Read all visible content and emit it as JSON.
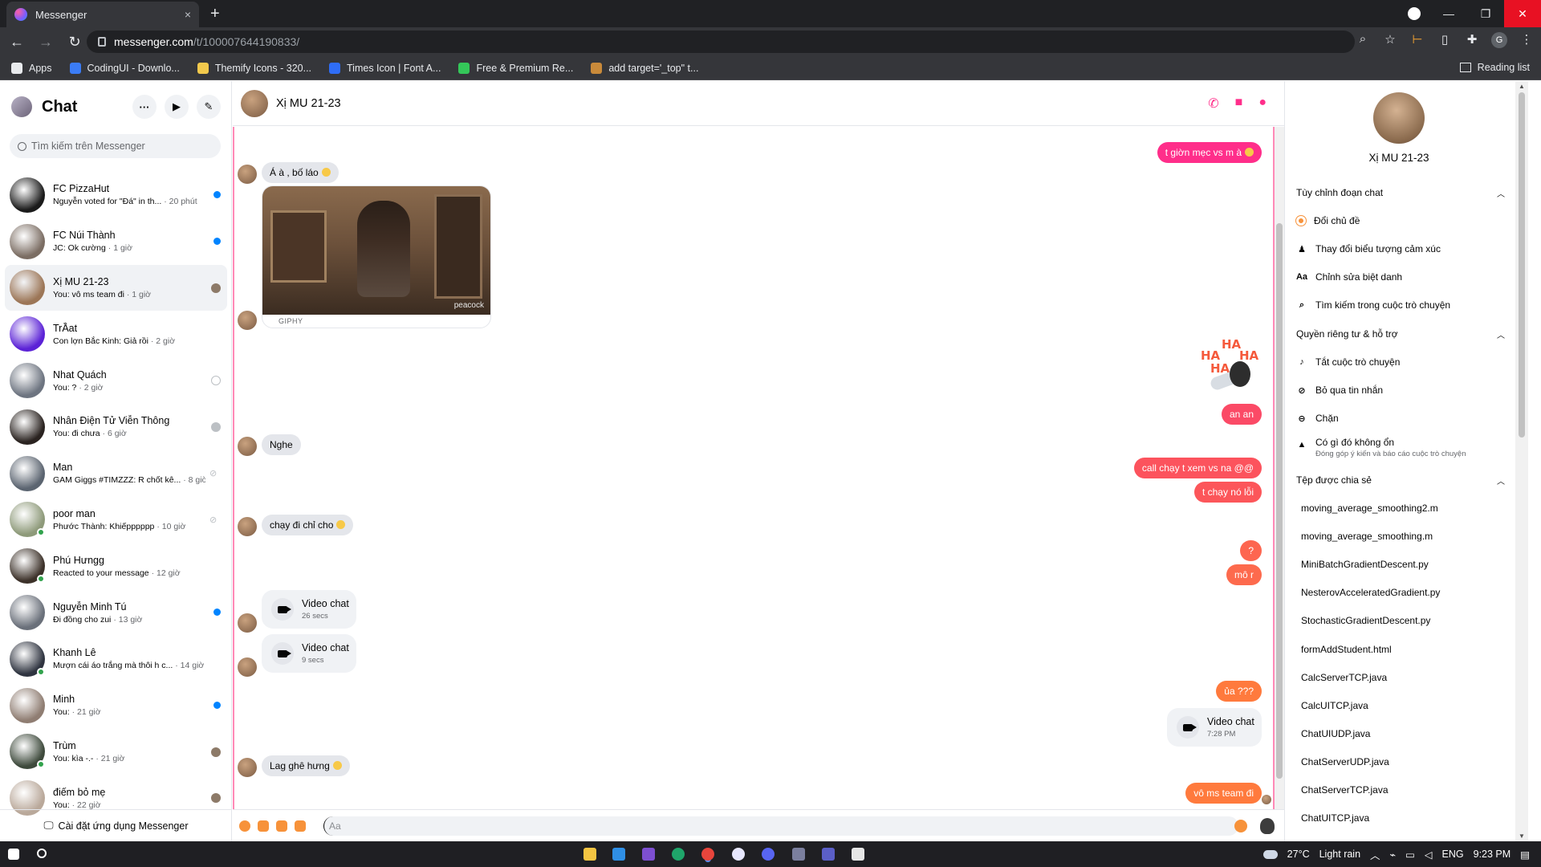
{
  "browser": {
    "tab_title": "Messenger",
    "tab_close": "×",
    "new_tab": "+",
    "url_host": "messenger.com",
    "url_path": "/t/100007644190833/",
    "bookmarks": [
      {
        "label": "Apps",
        "color": "#e8eaed"
      },
      {
        "label": "CodingUI - Downlo...",
        "color": "#3b7cf5"
      },
      {
        "label": "Themify Icons - 320...",
        "color": "#f2c94c"
      },
      {
        "label": "Times Icon | Font A...",
        "color": "#2f6df6"
      },
      {
        "label": "Free & Premium Re...",
        "color": "#34c759"
      },
      {
        "label": "add target='_top\" t...",
        "color": "#c98a3a"
      }
    ],
    "reading_list": "Reading list",
    "profile_initial": "G"
  },
  "sidebar": {
    "title": "Chat",
    "search_placeholder": "Tìm kiếm trên Messenger",
    "footer": "Cài đặt ứng dụng Messenger",
    "conversations": [
      {
        "name": "FC PizzaHut",
        "preview": "Nguyễn voted for \"Đá\" in th...",
        "time": "· 20 phút",
        "indicator": "unread",
        "online": false,
        "avatar_color": "#1b1b1b"
      },
      {
        "name": "FC Núi Thành",
        "preview": "JC: Ok cường",
        "time": "· 1 giờ",
        "indicator": "unread",
        "online": false,
        "avatar_color": "#7b6d63"
      },
      {
        "name": "Xị MU 21-23",
        "preview": "You: vô ms team đi",
        "time": "· 1 giờ",
        "indicator": "seen",
        "online": false,
        "avatar_color": "#9c7657"
      },
      {
        "name": "TrẦat",
        "preview": "Con lợn Bắc Kinh: Giả rồi",
        "time": "· 2 giờ",
        "indicator": "none",
        "online": false,
        "avatar_color": "#5b22d6"
      },
      {
        "name": "Nhat Quách",
        "preview": "You: ?",
        "time": "· 2 giờ",
        "indicator": "sent",
        "online": false,
        "avatar_color": "#6d7480"
      },
      {
        "name": "Nhân Điện Tử Viễn Thông",
        "preview": "You: đi chưa",
        "time": "· 6 giờ",
        "indicator": "deliv",
        "online": false,
        "avatar_color": "#2a2320"
      },
      {
        "name": "Man",
        "preview": "GAM Giggs #TIMZZZ: R chốt kê...",
        "time": "· 8 giờ",
        "indicator": "muted",
        "online": false,
        "avatar_color": "#5b6470"
      },
      {
        "name": "poor man",
        "preview": "Phước Thành: Khiếpppppp",
        "time": "· 10 giờ",
        "indicator": "muted",
        "online": true,
        "avatar_color": "#8e9a7a"
      },
      {
        "name": "Phú Hưngg",
        "preview": "Reacted to your message",
        "time": "· 12 giờ",
        "indicator": "none",
        "online": true,
        "avatar_color": "#3c3129"
      },
      {
        "name": "Nguyễn Minh Tú",
        "preview": "Đi đồng cho zui",
        "time": "· 13 giờ",
        "indicator": "unread",
        "online": false,
        "avatar_color": "#6a707a"
      },
      {
        "name": "Khanh Lê",
        "preview": "Mượn cái áo trắng mà thôi h c...",
        "time": "· 14 giờ",
        "indicator": "none",
        "online": true,
        "avatar_color": "#2f3440"
      },
      {
        "name": "Minh",
        "preview": "You:",
        "time": "· 21 giờ",
        "indicator": "unread",
        "online": false,
        "avatar_color": "#8f7d72"
      },
      {
        "name": "Trùm",
        "preview": "You: kìa -.-",
        "time": "· 21 giờ",
        "indicator": "seen",
        "online": true,
        "avatar_color": "#3e4a3c"
      },
      {
        "name": "điếm bỏ mẹ",
        "preview": "You:",
        "time": "· 22 giờ",
        "indicator": "seen",
        "online": false,
        "avatar_color": "#b9a89a"
      }
    ]
  },
  "chat": {
    "name": "Xị MU 21-23",
    "gif_caption": "GIPHY",
    "gif_watermark": "peacock",
    "sticker_text": [
      "HA",
      "HA",
      "HA",
      "HA"
    ],
    "messages": {
      "m1": "t giờn mẹc vs m à",
      "m2": "Á à , bố láo",
      "m3": "an an",
      "m4": "Nghe",
      "m5": "call chạy t xem vs na @@",
      "m6": "t chạy nó lỗi",
      "m7": "chạy đi chỉ cho",
      "m8": "?",
      "m9": "mô r",
      "m10": "ủa ???",
      "m11": "Lag ghê hưng",
      "m12": "vô ms team đi"
    },
    "video_calls": [
      {
        "title": "Video chat",
        "sub": "26 secs"
      },
      {
        "title": "Video chat",
        "sub": "9 secs"
      },
      {
        "title": "Video chat",
        "sub": "7:28 PM"
      }
    ],
    "composer_placeholder": "Aa",
    "accent": "#ff2e8a",
    "outgoing_gradient_top": "#ff2e8a",
    "outgoing_gradient_bottom": "#ff7a3d"
  },
  "info_panel": {
    "name": "Xị MU 21-23",
    "section_customize": "Tùy chỉnh đoạn chat",
    "change_theme": "Đổi chủ đề",
    "change_emoji": "Thay đổi biểu tượng cảm xúc",
    "edit_nicknames": "Chỉnh sửa biệt danh",
    "search_in_chat": "Tìm kiếm trong cuộc trò chuyện",
    "section_privacy": "Quyền riêng tư & hỗ trợ",
    "mute": "Tắt cuộc trò chuyện",
    "ignore": "Bỏ qua tin nhắn",
    "block": "Chặn",
    "something_wrong": "Có gì đó không ổn",
    "something_wrong_sub": "Đóng góp ý kiến và báo cáo cuộc trò chuyện",
    "section_files": "Tệp được chia sẻ",
    "files": [
      "moving_average_smoothing2.m",
      "moving_average_smoothing.m",
      "MiniBatchGradientDescent.py",
      "NesterovAcceleratedGradient.py",
      "StochasticGradientDescent.py",
      "formAddStudent.html",
      "CalcServerTCP.java",
      "CalcUITCP.java",
      "ChatUIUDP.java",
      "ChatServerUDP.java",
      "ChatServerTCP.java",
      "ChatUITCP.java"
    ]
  },
  "taskbar": {
    "temperature": "27°C",
    "weather": "Light rain",
    "lang": "ENG",
    "time": "9:23 PM"
  }
}
